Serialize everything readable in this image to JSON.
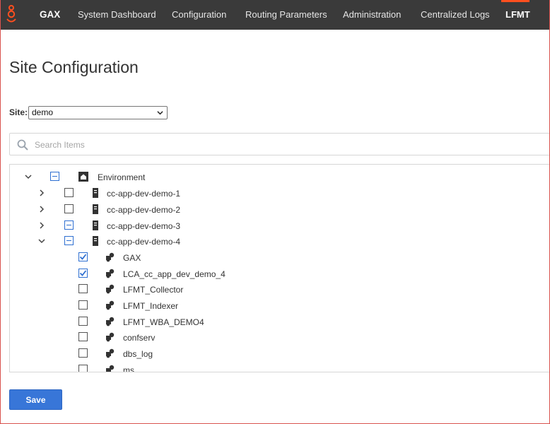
{
  "nav": {
    "logo_icon": "genesys-logo-icon",
    "brand": "GAX",
    "items": [
      {
        "label": "System Dashboard"
      },
      {
        "label": "Configuration"
      },
      {
        "label": "Routing Parameters"
      },
      {
        "label": "Administration"
      },
      {
        "label": "Centralized Logs"
      },
      {
        "label": "LFMT"
      }
    ],
    "active": "LFMT",
    "accent_color": "#ff4f1f"
  },
  "page": {
    "title": "Site Configuration"
  },
  "site": {
    "label": "Site:",
    "selected": "demo"
  },
  "search": {
    "placeholder": "Search Items"
  },
  "tree": {
    "rows": [
      {
        "label": "Environment",
        "expanded": true,
        "checkbox": "partial",
        "icon": "home-icon"
      },
      {
        "label": "cc-app-dev-demo-1",
        "expanded": false,
        "checkbox": "unchecked",
        "icon": "server-icon"
      },
      {
        "label": "cc-app-dev-demo-2",
        "expanded": false,
        "checkbox": "unchecked",
        "icon": "server-icon"
      },
      {
        "label": "cc-app-dev-demo-3",
        "expanded": false,
        "checkbox": "partial",
        "icon": "server-icon"
      },
      {
        "label": "cc-app-dev-demo-4",
        "expanded": true,
        "checkbox": "partial",
        "icon": "server-icon"
      },
      {
        "label": "GAX",
        "checkbox": "checked",
        "icon": "application-icon"
      },
      {
        "label": "LCA_cc_app_dev_demo_4",
        "checkbox": "checked",
        "icon": "application-icon"
      },
      {
        "label": "LFMT_Collector",
        "checkbox": "unchecked",
        "icon": "application-icon"
      },
      {
        "label": "LFMT_Indexer",
        "checkbox": "unchecked",
        "icon": "application-icon"
      },
      {
        "label": "LFMT_WBA_DEMO4",
        "checkbox": "unchecked",
        "icon": "application-icon"
      },
      {
        "label": "confserv",
        "checkbox": "unchecked",
        "icon": "application-icon"
      },
      {
        "label": "dbs_log",
        "checkbox": "unchecked",
        "icon": "application-icon"
      },
      {
        "label": "ms",
        "checkbox": "unchecked",
        "icon": "application-icon"
      }
    ]
  },
  "actions": {
    "save_label": "Save"
  }
}
